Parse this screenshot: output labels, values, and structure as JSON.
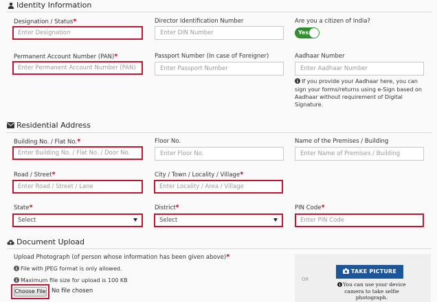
{
  "identity": {
    "heading": "Identity Information",
    "designation": {
      "label": "Designation / Status",
      "placeholder": "Enter Designation"
    },
    "din": {
      "label": "Director Identification Number",
      "placeholder": "Enter DIN Number"
    },
    "citizen": {
      "label": "Are you a citizen of India?",
      "toggle_label": "Yes",
      "value": true
    },
    "pan": {
      "label": "Permanent Account Number (PAN)",
      "placeholder": "Enter Permanent Account Number (PAN)"
    },
    "passport": {
      "label": "Passport Number (In case of Foreigner)",
      "placeholder": "Enter Passport Number"
    },
    "aadhaar": {
      "label": "Aadhaar Number",
      "placeholder": "Enter Aadhaar Number",
      "note": "If you provide your Aadhaar here, you can sign your forms/returns using e-Sign based on Aadhaar without requirement of Digital Signature."
    }
  },
  "residential": {
    "heading": "Residential Address",
    "building": {
      "label": "Building No. / Flat No.",
      "placeholder": "Enter Building No. / Flat No. / Door No."
    },
    "floor": {
      "label": "Floor No.",
      "placeholder": "Enter Floor No."
    },
    "premises": {
      "label": "Name of the Premises / Building",
      "placeholder": "Enter Name of Premises / Building"
    },
    "road": {
      "label": "Road / Street",
      "placeholder": "Enter Road / Street / Lane"
    },
    "city": {
      "label": "City / Town / Locality / Village",
      "placeholder": "Enter Locality / Area / Village"
    },
    "state": {
      "label": "State",
      "value": "Select"
    },
    "district": {
      "label": "District",
      "value": "Select"
    },
    "pin": {
      "label": "PIN Code",
      "placeholder": "Enter PIN Code"
    }
  },
  "upload": {
    "heading": "Document Upload",
    "photo_label": "Upload Photograph (of person whose information has been given above)",
    "format_note": "File with JPEG format is only allowed.",
    "size_note": "Maximum file size for upload is 100 KB",
    "choose_button": "Choose File",
    "no_file_text": "No file chosen",
    "or_text": "OR",
    "take_picture_button": "TAKE PICTURE",
    "camera_note": "You can use your device camera to take selfie photograph."
  },
  "colors": {
    "required": "#d0021b",
    "error_border": "#c4122f",
    "toggle_on": "#2f8f2f",
    "primary_button": "#1d5599"
  },
  "icons": {
    "identity": "user-icon",
    "residential": "envelope-icon",
    "upload": "cloud-upload-icon",
    "info": "info-circle-icon",
    "camera": "camera-icon"
  }
}
